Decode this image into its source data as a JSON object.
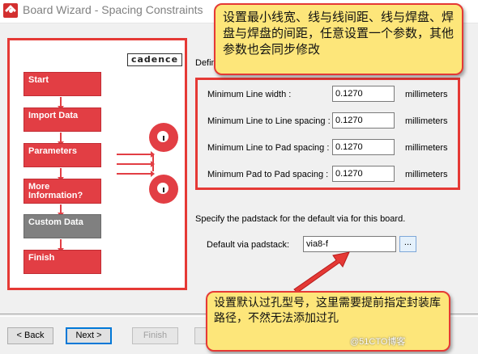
{
  "window": {
    "title": "Board Wizard - Spacing Constraints"
  },
  "logo": "cadence",
  "flow": [
    {
      "label": "Start",
      "state": "active"
    },
    {
      "label": "Import Data",
      "state": "active"
    },
    {
      "label": "Parameters",
      "state": "active"
    },
    {
      "label": "More\nInformation?",
      "state": "active"
    },
    {
      "label": "Custom Data",
      "state": "inactive"
    },
    {
      "label": "Finish",
      "state": "active"
    }
  ],
  "constraints": {
    "group_label": "Defin",
    "rows": [
      {
        "label": "Minimum Line width :",
        "value": "0.1270",
        "unit": "millimeters"
      },
      {
        "label": "Minimum Line to Line spacing :",
        "value": "0.1270",
        "unit": "millimeters"
      },
      {
        "label": "Minimum Line to Pad spacing :",
        "value": "0.1270",
        "unit": "millimeters"
      },
      {
        "label": "Minimum Pad to Pad spacing :",
        "value": "0.1270",
        "unit": "millimeters"
      }
    ]
  },
  "padstack": {
    "hint": "Specify the padstack for the default via for this board.",
    "label": "Default via padstack:",
    "value": "via8-f",
    "browse_label": "..."
  },
  "buttons": {
    "back": "< Back",
    "next": "Next >",
    "finish": "Finish"
  },
  "annotations": {
    "top": "设置最小线宽、线与线间距、线与焊盘、焊盘与焊盘的间距，任意设置一个参数，其他参数也会同步修改",
    "bottom": "设置默认过孔型号，这里需要提前指定封装库路径，不然无法添加过孔"
  },
  "watermark": "@51CTO博客",
  "colors": {
    "accent": "#e53935",
    "note_bg": "#fde67a"
  }
}
